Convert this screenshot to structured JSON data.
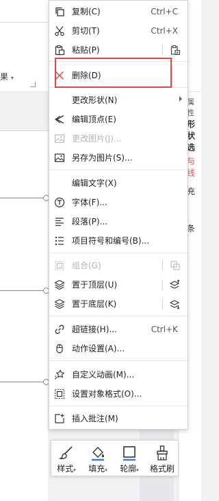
{
  "background": {
    "ribbon_label": "果",
    "right_panel": [
      "属性",
      "形状选",
      "与线",
      "充",
      "条"
    ]
  },
  "context_menu": {
    "items": [
      {
        "label": "复制(C)",
        "shortcut": "Ctrl+C",
        "icon": "copy-icon",
        "enabled": true
      },
      {
        "label": "剪切(T)",
        "shortcut": "Ctrl+X",
        "icon": "scissors-icon",
        "enabled": true
      },
      {
        "label": "粘贴(P)",
        "shortcut": "",
        "icon": "paste-icon",
        "enabled": true
      },
      {
        "label": "删除(D)",
        "shortcut": "",
        "icon": "delete-x-icon",
        "enabled": true
      },
      {
        "label": "更改形状(N)",
        "shortcut": "",
        "icon": "",
        "enabled": true,
        "submenu": true
      },
      {
        "label": "编辑顶点(E)",
        "shortcut": "",
        "icon": "edit-vertex-icon",
        "enabled": true
      },
      {
        "label": "更改图片(J)...",
        "shortcut": "",
        "icon": "change-picture-icon",
        "enabled": false
      },
      {
        "label": "另存为图片(S)...",
        "shortcut": "",
        "icon": "save-as-picture-icon",
        "enabled": true
      },
      {
        "label": "编辑文字(X)",
        "shortcut": "",
        "icon": "",
        "enabled": true
      },
      {
        "label": "字体(F)...",
        "shortcut": "",
        "icon": "font-icon",
        "enabled": true
      },
      {
        "label": "段落(P)...",
        "shortcut": "",
        "icon": "paragraph-icon",
        "enabled": true
      },
      {
        "label": "项目符号和编号(B)...",
        "shortcut": "",
        "icon": "bullets-icon",
        "enabled": true
      },
      {
        "label": "组合(G)",
        "shortcut": "",
        "icon": "group-icon",
        "enabled": false
      },
      {
        "label": "置于顶层(U)",
        "shortcut": "",
        "icon": "bring-to-front-icon",
        "enabled": true
      },
      {
        "label": "置于底层(K)",
        "shortcut": "",
        "icon": "send-to-back-icon",
        "enabled": true
      },
      {
        "label": "超链接(H)...",
        "shortcut": "Ctrl+K",
        "icon": "hyperlink-icon",
        "enabled": true
      },
      {
        "label": "动作设置(A)...",
        "shortcut": "",
        "icon": "mouse-icon",
        "enabled": true
      },
      {
        "label": "自定义动画(M)...",
        "shortcut": "",
        "icon": "star-animation-icon",
        "enabled": true
      },
      {
        "label": "设置对象格式(O)...",
        "shortcut": "",
        "icon": "format-object-icon",
        "enabled": true
      },
      {
        "label": "插入批注(M)",
        "shortcut": "",
        "icon": "comment-icon",
        "enabled": true
      }
    ]
  },
  "float_toolbar": {
    "buttons": [
      {
        "label": "样式",
        "icon": "brush-style-icon",
        "dropdown": true
      },
      {
        "label": "填充",
        "icon": "fill-bucket-icon",
        "dropdown": true
      },
      {
        "label": "轮廓",
        "icon": "outline-icon",
        "dropdown": true
      },
      {
        "label": "格式刷",
        "icon": "format-painter-icon",
        "dropdown": false
      }
    ]
  },
  "colors": {
    "highlight": "#e24545",
    "accent_blue": "#3b7ddd",
    "delete_red": "#e24545"
  }
}
